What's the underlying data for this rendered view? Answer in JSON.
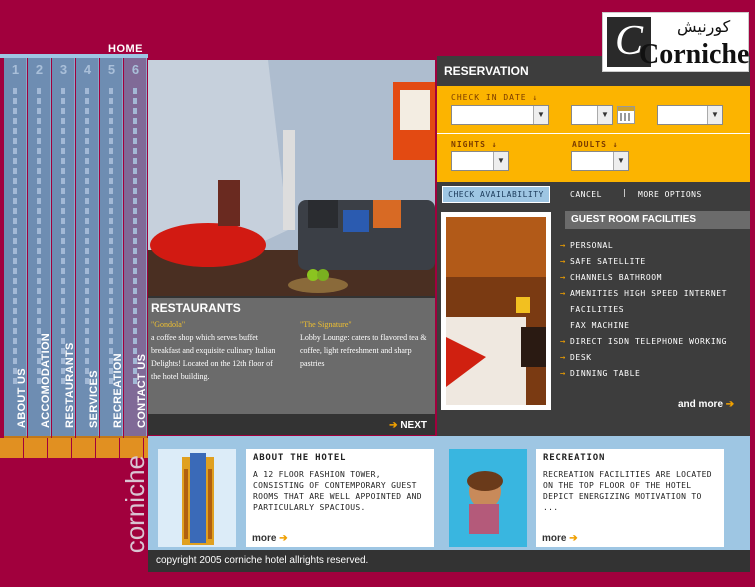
{
  "nav": {
    "home": "HOME",
    "items": [
      {
        "num": "1",
        "label": "ABOUT US"
      },
      {
        "num": "2",
        "label": "ACCOMODATION"
      },
      {
        "num": "3",
        "label": "RESTAURANTS"
      },
      {
        "num": "4",
        "label": "SERVICES"
      },
      {
        "num": "5",
        "label": "RECREATION"
      },
      {
        "num": "6",
        "label": "CONTACT US"
      }
    ]
  },
  "side_brand": "corniche",
  "logo": {
    "text": "Corniche",
    "arabic": "كورنيش"
  },
  "restaurants": {
    "title": "RESTAURANTS",
    "a_name": "\"Gondola\"",
    "a_text": "a coffee shop which serves buffet breakfast and exquisite culinary Italian Delights! Located on the 12th floor of the hotel building.",
    "b_name": "\"The Signature\"",
    "b_text": "Lobby Lounge: caters to flavored tea & coffee, light refreshment and sharp pastries",
    "next": "NEXT"
  },
  "reservation": {
    "title": "RESERVATION",
    "checkin": "CHECK IN DATE",
    "nights": "NIGHTS",
    "adults": "ADULTS",
    "check_btn": "CHECK AVAILABILITY",
    "cancel": "CANCEL",
    "sep": "|",
    "more_options": "MORE OPTIONS"
  },
  "facilities": {
    "title": "GUEST ROOM FACILITIES",
    "items": [
      {
        "t": "PERSONAL",
        "arrow": true
      },
      {
        "t": "SAFE SATELLITE",
        "arrow": true
      },
      {
        "t": "CHANNELS BATHROOM",
        "arrow": true
      },
      {
        "t": "AMENITIES HIGH SPEED INTERNET",
        "arrow": true
      },
      {
        "t": "FACILITIES",
        "arrow": false
      },
      {
        "t": "FAX MACHINE",
        "arrow": false
      },
      {
        "t": "DIRECT ISDN TELEPHONE WORKING",
        "arrow": true
      },
      {
        "t": "DESK",
        "arrow": true
      },
      {
        "t": "DINNING TABLE",
        "arrow": true
      }
    ],
    "and_more": "and more"
  },
  "about": {
    "title": "ABOUT THE HOTEL",
    "text": "A 12 FLOOR FASHION TOWER, CONSISTING  OF CONTEMPORARY GUEST ROOMS THAT ARE WELL APPOINTED AND PARTICULARLY SPACIOUS.",
    "more": "more"
  },
  "recreation": {
    "title": "RECREATION",
    "text": "RECREATION FACILITIES ARE LOCATED ON THE TOP FLOOR OF THE HOTEL DEPICT ENERGIZING MOTIVATION TO ...",
    "more": "more"
  },
  "footer": "copyright 2005 corniche hotel allrights reserved."
}
